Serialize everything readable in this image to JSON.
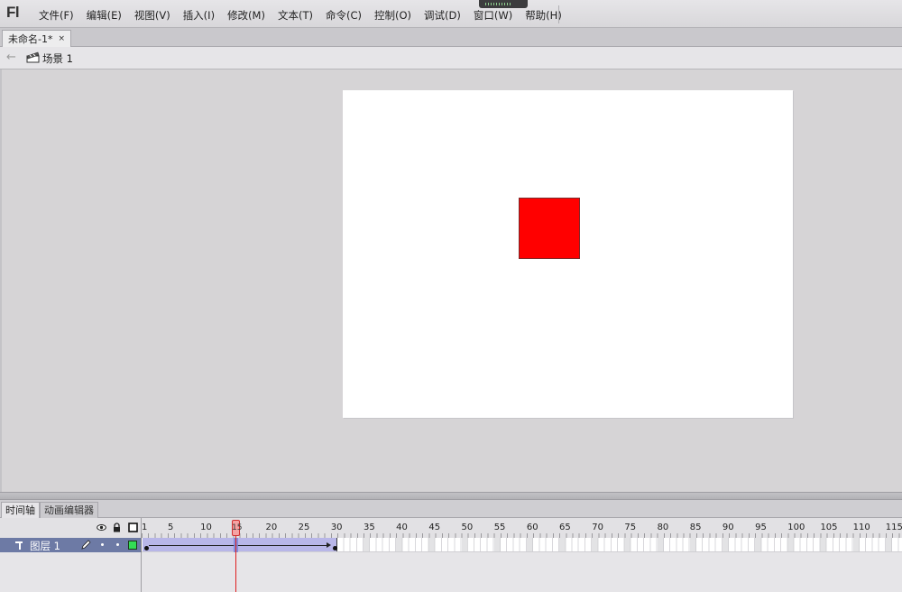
{
  "app": {
    "logo": "Fl"
  },
  "menu": [
    "文件(F)",
    "编辑(E)",
    "视图(V)",
    "插入(I)",
    "修改(M)",
    "文本(T)",
    "命令(C)",
    "控制(O)",
    "调试(D)",
    "窗口(W)",
    "帮助(H)"
  ],
  "document_tab": {
    "label": "未命名-1*",
    "close": "×"
  },
  "editbar": {
    "back": "←",
    "scene_label": "场景 1"
  },
  "stage": {
    "background": "#ffffff",
    "shape_color": "#ff0000"
  },
  "panel_tabs": {
    "timeline": "时间轴",
    "motion_editor": "动画编辑器"
  },
  "timeline": {
    "ruler_labels": [
      "1",
      "5",
      "10",
      "",
      "20",
      "25",
      "30",
      "35",
      "40",
      "45",
      "50",
      "55",
      "60",
      "65",
      "70",
      "75",
      "80",
      "85",
      "90",
      "95",
      "100",
      "105",
      "110",
      "115"
    ],
    "current_frame": "15",
    "layer": {
      "name": "图层 1",
      "color": "#33dd55",
      "tween_start_frame": 1,
      "tween_end_frame": 30
    }
  }
}
